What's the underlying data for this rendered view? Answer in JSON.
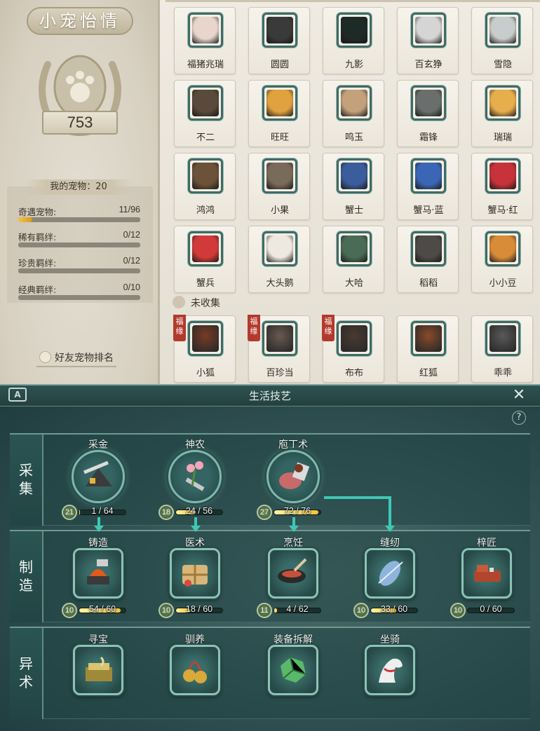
{
  "pet_panel": {
    "title": "小宠怡情",
    "score": "753",
    "my_pets": "我的宠物：20",
    "stats": [
      {
        "label": "奇遇宠物:",
        "value": "11/96",
        "progress": 0.115
      },
      {
        "label": "稀有羁绊:",
        "value": "0/12",
        "progress": 0
      },
      {
        "label": "珍贵羁绊:",
        "value": "0/12",
        "progress": 0
      },
      {
        "label": "经典羁绊:",
        "value": "0/10",
        "progress": 0
      }
    ],
    "friend_rank": "好友宠物排名",
    "pets": [
      {
        "name": "福猪兆瑞",
        "color": "#e8d5cc",
        "icon": "pig-icon"
      },
      {
        "name": "圆圆",
        "color": "#3a3a3a",
        "icon": "raccoon-icon"
      },
      {
        "name": "九影",
        "color": "#1e2a28",
        "icon": "black-cat-icon"
      },
      {
        "name": "百玄狰",
        "color": "#d5d5d5",
        "icon": "white-cat-icon"
      },
      {
        "name": "雪隐",
        "color": "#c9cccc",
        "icon": "snow-cat-icon"
      },
      {
        "name": "不二",
        "color": "#5a4a3c",
        "icon": "hat-dog-icon"
      },
      {
        "name": "旺旺",
        "color": "#e0a23f",
        "icon": "shiba-icon"
      },
      {
        "name": "鸣玉",
        "color": "#c2a17b",
        "icon": "tabby-cat-icon"
      },
      {
        "name": "霜锋",
        "color": "#6a6e6c",
        "icon": "grey-dog-icon"
      },
      {
        "name": "瑞瑞",
        "color": "#e6ae4c",
        "icon": "pomeranian-icon"
      },
      {
        "name": "鸿鸿",
        "color": "#6b5238",
        "icon": "pekingese-icon"
      },
      {
        "name": "小果",
        "color": "#7a6a5a",
        "icon": "hedgehog-icon"
      },
      {
        "name": "蟹士",
        "color": "#3b5d9c",
        "icon": "blue-crab-icon"
      },
      {
        "name": "蟹马·蓝",
        "color": "#3a66b5",
        "icon": "blue-crab-icon"
      },
      {
        "name": "蟹马·红",
        "color": "#c8323a",
        "icon": "red-crab-icon"
      },
      {
        "name": "蟹兵",
        "color": "#d23a3a",
        "icon": "red-crab-icon"
      },
      {
        "name": "大头鹅",
        "color": "#ede8e0",
        "icon": "goose-icon"
      },
      {
        "name": "大哈",
        "color": "#4a6b56",
        "icon": "toad-icon"
      },
      {
        "name": "稻稻",
        "color": "#4e4a48",
        "icon": "badger-icon"
      },
      {
        "name": "小小豆",
        "color": "#d98c38",
        "icon": "corgi-icon"
      }
    ],
    "uncollected_label": "未收集",
    "uncollected": [
      {
        "name": "小狐",
        "color": "#7a3a24",
        "tag": "福缘"
      },
      {
        "name": "百珍当",
        "color": "#6a5a50",
        "tag": "福缘"
      },
      {
        "name": "布布",
        "color": "#4a3a30",
        "tag": "福缘"
      },
      {
        "name": "红狐",
        "color": "#8b4a2a",
        "tag": ""
      },
      {
        "name": "乖乖",
        "color": "#5a5a5a",
        "tag": ""
      }
    ]
  },
  "skill_panel": {
    "title": "生活技艺",
    "logo": "A",
    "close": "✕",
    "help": "?",
    "rows": [
      {
        "label": [
          "采",
          "集"
        ]
      },
      {
        "label": [
          "制",
          "造"
        ]
      },
      {
        "label": [
          "异",
          "术"
        ]
      }
    ],
    "gather": [
      {
        "name": "采金",
        "level": "21",
        "progress_text": "1 / 64",
        "progress": 0.016,
        "icon": "pickaxe-ore-icon"
      },
      {
        "name": "神农",
        "level": "18",
        "progress_text": "24 / 56",
        "progress": 0.43,
        "icon": "herb-shovel-icon"
      },
      {
        "name": "庖丁术",
        "level": "27",
        "progress_text": "72 / 76",
        "progress": 0.95,
        "icon": "meat-cleaver-icon"
      }
    ],
    "craft": [
      {
        "name": "铸造",
        "level": "10",
        "progress_text": "54 / 60",
        "progress": 0.9,
        "icon": "anvil-hammer-icon"
      },
      {
        "name": "医术",
        "level": "10",
        "progress_text": "18 / 60",
        "progress": 0.3,
        "icon": "medicine-pack-icon"
      },
      {
        "name": "烹饪",
        "level": "11",
        "progress_text": "4 / 62",
        "progress": 0.065,
        "icon": "wok-icon"
      },
      {
        "name": "缝纫",
        "level": "10",
        "progress_text": "33 / 60",
        "progress": 0.55,
        "icon": "thread-spool-icon"
      },
      {
        "name": "梓匠",
        "level": "10",
        "progress_text": "0 / 60",
        "progress": 0,
        "icon": "wood-plane-icon"
      }
    ],
    "misc": [
      {
        "name": "寻宝",
        "icon": "treasure-map-icon"
      },
      {
        "name": "驯养",
        "icon": "bells-icon"
      },
      {
        "name": "装备拆解",
        "icon": "broken-jade-icon"
      },
      {
        "name": "坐骑",
        "icon": "horse-icon"
      }
    ]
  }
}
